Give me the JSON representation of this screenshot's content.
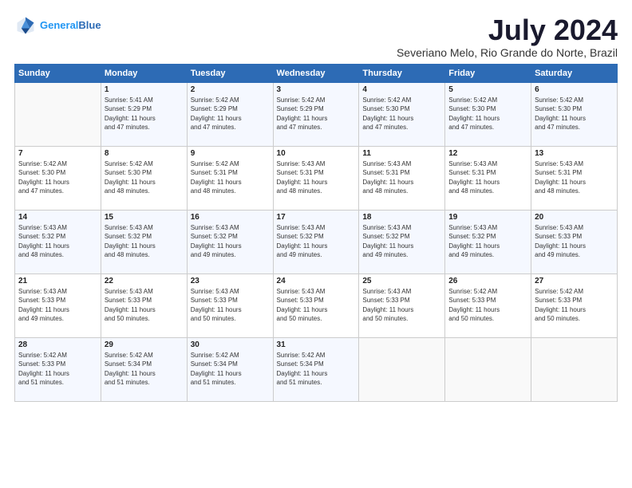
{
  "header": {
    "logo_line1": "General",
    "logo_line2": "Blue",
    "month_year": "July 2024",
    "location": "Severiano Melo, Rio Grande do Norte, Brazil"
  },
  "days_of_week": [
    "Sunday",
    "Monday",
    "Tuesday",
    "Wednesday",
    "Thursday",
    "Friday",
    "Saturday"
  ],
  "weeks": [
    [
      {
        "day": "",
        "info": ""
      },
      {
        "day": "1",
        "info": "Sunrise: 5:41 AM\nSunset: 5:29 PM\nDaylight: 11 hours\nand 47 minutes."
      },
      {
        "day": "2",
        "info": "Sunrise: 5:42 AM\nSunset: 5:29 PM\nDaylight: 11 hours\nand 47 minutes."
      },
      {
        "day": "3",
        "info": "Sunrise: 5:42 AM\nSunset: 5:29 PM\nDaylight: 11 hours\nand 47 minutes."
      },
      {
        "day": "4",
        "info": "Sunrise: 5:42 AM\nSunset: 5:30 PM\nDaylight: 11 hours\nand 47 minutes."
      },
      {
        "day": "5",
        "info": "Sunrise: 5:42 AM\nSunset: 5:30 PM\nDaylight: 11 hours\nand 47 minutes."
      },
      {
        "day": "6",
        "info": "Sunrise: 5:42 AM\nSunset: 5:30 PM\nDaylight: 11 hours\nand 47 minutes."
      }
    ],
    [
      {
        "day": "7",
        "info": "Sunrise: 5:42 AM\nSunset: 5:30 PM\nDaylight: 11 hours\nand 47 minutes."
      },
      {
        "day": "8",
        "info": "Sunrise: 5:42 AM\nSunset: 5:30 PM\nDaylight: 11 hours\nand 48 minutes."
      },
      {
        "day": "9",
        "info": "Sunrise: 5:42 AM\nSunset: 5:31 PM\nDaylight: 11 hours\nand 48 minutes."
      },
      {
        "day": "10",
        "info": "Sunrise: 5:43 AM\nSunset: 5:31 PM\nDaylight: 11 hours\nand 48 minutes."
      },
      {
        "day": "11",
        "info": "Sunrise: 5:43 AM\nSunset: 5:31 PM\nDaylight: 11 hours\nand 48 minutes."
      },
      {
        "day": "12",
        "info": "Sunrise: 5:43 AM\nSunset: 5:31 PM\nDaylight: 11 hours\nand 48 minutes."
      },
      {
        "day": "13",
        "info": "Sunrise: 5:43 AM\nSunset: 5:31 PM\nDaylight: 11 hours\nand 48 minutes."
      }
    ],
    [
      {
        "day": "14",
        "info": "Sunrise: 5:43 AM\nSunset: 5:32 PM\nDaylight: 11 hours\nand 48 minutes."
      },
      {
        "day": "15",
        "info": "Sunrise: 5:43 AM\nSunset: 5:32 PM\nDaylight: 11 hours\nand 48 minutes."
      },
      {
        "day": "16",
        "info": "Sunrise: 5:43 AM\nSunset: 5:32 PM\nDaylight: 11 hours\nand 49 minutes."
      },
      {
        "day": "17",
        "info": "Sunrise: 5:43 AM\nSunset: 5:32 PM\nDaylight: 11 hours\nand 49 minutes."
      },
      {
        "day": "18",
        "info": "Sunrise: 5:43 AM\nSunset: 5:32 PM\nDaylight: 11 hours\nand 49 minutes."
      },
      {
        "day": "19",
        "info": "Sunrise: 5:43 AM\nSunset: 5:32 PM\nDaylight: 11 hours\nand 49 minutes."
      },
      {
        "day": "20",
        "info": "Sunrise: 5:43 AM\nSunset: 5:33 PM\nDaylight: 11 hours\nand 49 minutes."
      }
    ],
    [
      {
        "day": "21",
        "info": "Sunrise: 5:43 AM\nSunset: 5:33 PM\nDaylight: 11 hours\nand 49 minutes."
      },
      {
        "day": "22",
        "info": "Sunrise: 5:43 AM\nSunset: 5:33 PM\nDaylight: 11 hours\nand 50 minutes."
      },
      {
        "day": "23",
        "info": "Sunrise: 5:43 AM\nSunset: 5:33 PM\nDaylight: 11 hours\nand 50 minutes."
      },
      {
        "day": "24",
        "info": "Sunrise: 5:43 AM\nSunset: 5:33 PM\nDaylight: 11 hours\nand 50 minutes."
      },
      {
        "day": "25",
        "info": "Sunrise: 5:43 AM\nSunset: 5:33 PM\nDaylight: 11 hours\nand 50 minutes."
      },
      {
        "day": "26",
        "info": "Sunrise: 5:42 AM\nSunset: 5:33 PM\nDaylight: 11 hours\nand 50 minutes."
      },
      {
        "day": "27",
        "info": "Sunrise: 5:42 AM\nSunset: 5:33 PM\nDaylight: 11 hours\nand 50 minutes."
      }
    ],
    [
      {
        "day": "28",
        "info": "Sunrise: 5:42 AM\nSunset: 5:33 PM\nDaylight: 11 hours\nand 51 minutes."
      },
      {
        "day": "29",
        "info": "Sunrise: 5:42 AM\nSunset: 5:34 PM\nDaylight: 11 hours\nand 51 minutes."
      },
      {
        "day": "30",
        "info": "Sunrise: 5:42 AM\nSunset: 5:34 PM\nDaylight: 11 hours\nand 51 minutes."
      },
      {
        "day": "31",
        "info": "Sunrise: 5:42 AM\nSunset: 5:34 PM\nDaylight: 11 hours\nand 51 minutes."
      },
      {
        "day": "",
        "info": ""
      },
      {
        "day": "",
        "info": ""
      },
      {
        "day": "",
        "info": ""
      }
    ]
  ]
}
